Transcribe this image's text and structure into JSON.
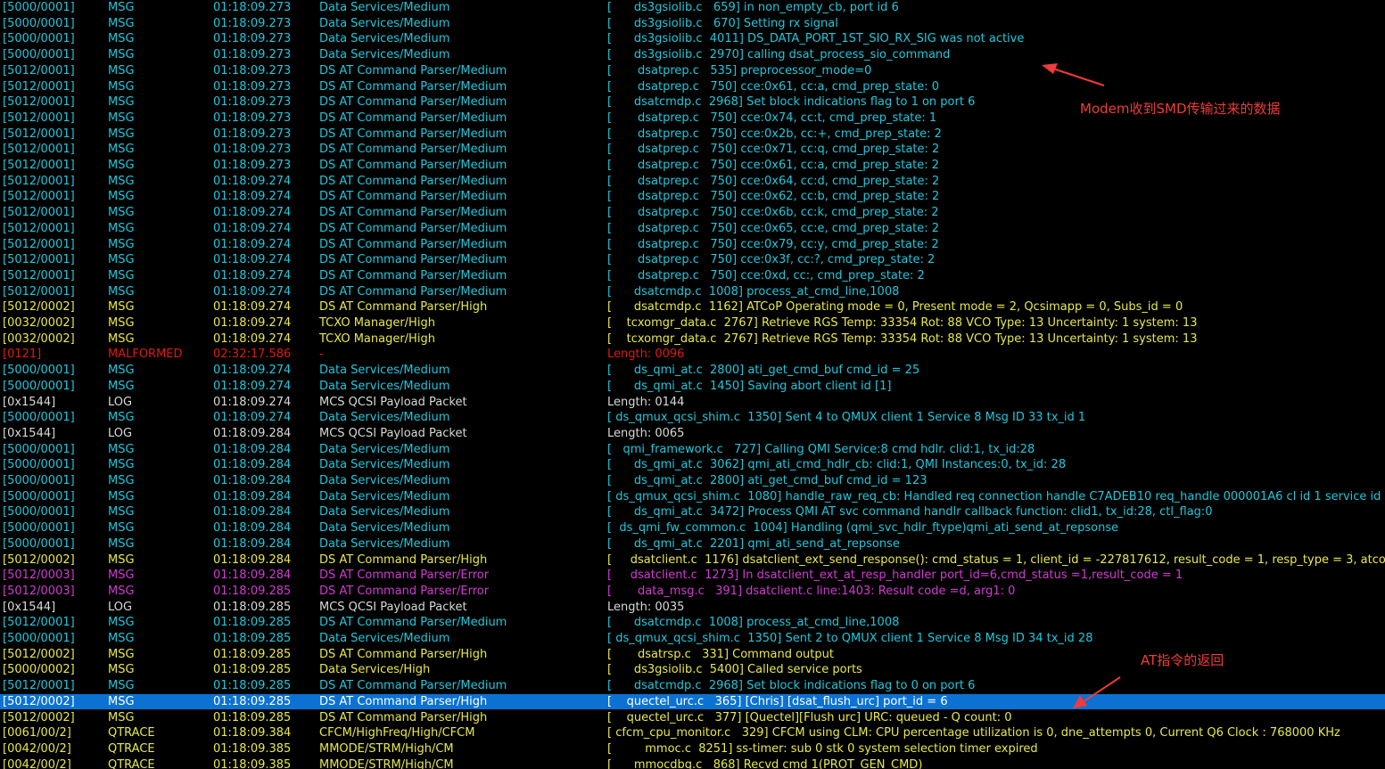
{
  "colors": {
    "cyan": "#1ec8dc",
    "yellow": "#e8e84a",
    "red": "#e01818",
    "white": "#d8d8d8",
    "magenta": "#d23ad2",
    "selection": "#0b72d4",
    "annotation": "#f23a3a"
  },
  "annotations": {
    "smd_note": "Modem收到SMD传输过来的数据",
    "at_return_note": "AT指令的返回"
  },
  "selected_row_index": 44,
  "rows": [
    {
      "id": "[5000/0001]",
      "type": "MSG",
      "time": "01:18:09.273",
      "subsystem": "Data Services/Medium",
      "message": "[      ds3gsiolib.c   659] in non_empty_cb, port id 6",
      "color": "cyan"
    },
    {
      "id": "[5000/0001]",
      "type": "MSG",
      "time": "01:18:09.273",
      "subsystem": "Data Services/Medium",
      "message": "[      ds3gsiolib.c   670] Setting rx signal",
      "color": "cyan"
    },
    {
      "id": "[5000/0001]",
      "type": "MSG",
      "time": "01:18:09.273",
      "subsystem": "Data Services/Medium",
      "message": "[      ds3gsiolib.c  4011] DS_DATA_PORT_1ST_SIO_RX_SIG was not active",
      "color": "cyan"
    },
    {
      "id": "[5000/0001]",
      "type": "MSG",
      "time": "01:18:09.273",
      "subsystem": "Data Services/Medium",
      "message": "[      ds3gsiolib.c  2970] calling dsat_process_sio_command",
      "color": "cyan"
    },
    {
      "id": "[5012/0001]",
      "type": "MSG",
      "time": "01:18:09.273",
      "subsystem": "DS AT Command Parser/Medium",
      "message": "[       dsatprep.c   535] preprocessor_mode=0",
      "color": "cyan"
    },
    {
      "id": "[5012/0001]",
      "type": "MSG",
      "time": "01:18:09.273",
      "subsystem": "DS AT Command Parser/Medium",
      "message": "[       dsatprep.c   750] cce:0x61, cc:a, cmd_prep_state: 0",
      "color": "cyan"
    },
    {
      "id": "[5012/0001]",
      "type": "MSG",
      "time": "01:18:09.273",
      "subsystem": "DS AT Command Parser/Medium",
      "message": "[      dsatcmdp.c  2968] Set block indications flag to 1 on port 6",
      "color": "cyan"
    },
    {
      "id": "[5012/0001]",
      "type": "MSG",
      "time": "01:18:09.273",
      "subsystem": "DS AT Command Parser/Medium",
      "message": "[       dsatprep.c   750] cce:0x74, cc:t, cmd_prep_state: 1",
      "color": "cyan"
    },
    {
      "id": "[5012/0001]",
      "type": "MSG",
      "time": "01:18:09.273",
      "subsystem": "DS AT Command Parser/Medium",
      "message": "[       dsatprep.c   750] cce:0x2b, cc:+, cmd_prep_state: 2",
      "color": "cyan"
    },
    {
      "id": "[5012/0001]",
      "type": "MSG",
      "time": "01:18:09.273",
      "subsystem": "DS AT Command Parser/Medium",
      "message": "[       dsatprep.c   750] cce:0x71, cc:q, cmd_prep_state: 2",
      "color": "cyan"
    },
    {
      "id": "[5012/0001]",
      "type": "MSG",
      "time": "01:18:09.273",
      "subsystem": "DS AT Command Parser/Medium",
      "message": "[       dsatprep.c   750] cce:0x61, cc:a, cmd_prep_state: 2",
      "color": "cyan"
    },
    {
      "id": "[5012/0001]",
      "type": "MSG",
      "time": "01:18:09.274",
      "subsystem": "DS AT Command Parser/Medium",
      "message": "[       dsatprep.c   750] cce:0x64, cc:d, cmd_prep_state: 2",
      "color": "cyan"
    },
    {
      "id": "[5012/0001]",
      "type": "MSG",
      "time": "01:18:09.274",
      "subsystem": "DS AT Command Parser/Medium",
      "message": "[       dsatprep.c   750] cce:0x62, cc:b, cmd_prep_state: 2",
      "color": "cyan"
    },
    {
      "id": "[5012/0001]",
      "type": "MSG",
      "time": "01:18:09.274",
      "subsystem": "DS AT Command Parser/Medium",
      "message": "[       dsatprep.c   750] cce:0x6b, cc:k, cmd_prep_state: 2",
      "color": "cyan"
    },
    {
      "id": "[5012/0001]",
      "type": "MSG",
      "time": "01:18:09.274",
      "subsystem": "DS AT Command Parser/Medium",
      "message": "[       dsatprep.c   750] cce:0x65, cc:e, cmd_prep_state: 2",
      "color": "cyan"
    },
    {
      "id": "[5012/0001]",
      "type": "MSG",
      "time": "01:18:09.274",
      "subsystem": "DS AT Command Parser/Medium",
      "message": "[       dsatprep.c   750] cce:0x79, cc:y, cmd_prep_state: 2",
      "color": "cyan"
    },
    {
      "id": "[5012/0001]",
      "type": "MSG",
      "time": "01:18:09.274",
      "subsystem": "DS AT Command Parser/Medium",
      "message": "[       dsatprep.c   750] cce:0x3f, cc:?, cmd_prep_state: 2",
      "color": "cyan"
    },
    {
      "id": "[5012/0001]",
      "type": "MSG",
      "time": "01:18:09.274",
      "subsystem": "DS AT Command Parser/Medium",
      "message": "[       dsatprep.c   750] cce:0xd, cc:, cmd_prep_state: 2",
      "color": "cyan"
    },
    {
      "id": "[5012/0001]",
      "type": "MSG",
      "time": "01:18:09.274",
      "subsystem": "DS AT Command Parser/Medium",
      "message": "[      dsatcmdp.c  1008] process_at_cmd_line,1008",
      "color": "cyan"
    },
    {
      "id": "[5012/0002]",
      "type": "MSG",
      "time": "01:18:09.274",
      "subsystem": "DS AT Command Parser/High",
      "message": "[      dsatcmdp.c  1162] ATCoP Operating mode = 0, Present mode = 2, Qcsimapp = 0, Subs_id = 0",
      "color": "yellow"
    },
    {
      "id": "[0032/0002]",
      "type": "MSG",
      "time": "01:18:09.274",
      "subsystem": "TCXO Manager/High",
      "message": "[    tcxomgr_data.c  2767] Retrieve RGS Temp: 33354 Rot: 88 VCO Type: 13 Uncertainty: 1 system: 13",
      "color": "yellow"
    },
    {
      "id": "[0032/0002]",
      "type": "MSG",
      "time": "01:18:09.274",
      "subsystem": "TCXO Manager/High",
      "message": "[    tcxomgr_data.c  2767] Retrieve RGS Temp: 33354 Rot: 88 VCO Type: 13 Uncertainty: 1 system: 13",
      "color": "yellow"
    },
    {
      "id": "[0121]",
      "type": "MALFORMED",
      "time": "02:32:17.586",
      "subsystem": "-",
      "message": "Length: 0096",
      "color": "red"
    },
    {
      "id": "[5000/0001]",
      "type": "MSG",
      "time": "01:18:09.274",
      "subsystem": "Data Services/Medium",
      "message": "[      ds_qmi_at.c  2800] ati_get_cmd_buf cmd_id = 25",
      "color": "cyan"
    },
    {
      "id": "[5000/0001]",
      "type": "MSG",
      "time": "01:18:09.274",
      "subsystem": "Data Services/Medium",
      "message": "[      ds_qmi_at.c  1450] Saving abort client id [1]",
      "color": "cyan"
    },
    {
      "id": "[0x1544]",
      "type": "LOG",
      "time": "01:18:09.274",
      "subsystem": "MCS QCSI Payload Packet",
      "message": "Length: 0144",
      "color": "white"
    },
    {
      "id": "[5000/0001]",
      "type": "MSG",
      "time": "01:18:09.274",
      "subsystem": "Data Services/Medium",
      "message": "[ ds_qmux_qcsi_shim.c  1350] Sent 4 to QMUX client 1 Service 8 Msg ID 33 tx_id 1",
      "color": "cyan"
    },
    {
      "id": "[0x1544]",
      "type": "LOG",
      "time": "01:18:09.284",
      "subsystem": "MCS QCSI Payload Packet",
      "message": "Length: 0065",
      "color": "white"
    },
    {
      "id": "[5000/0001]",
      "type": "MSG",
      "time": "01:18:09.284",
      "subsystem": "Data Services/Medium",
      "message": "[   qmi_framework.c   727] Calling QMI Service:8 cmd hdlr. clid:1, tx_id:28",
      "color": "cyan"
    },
    {
      "id": "[5000/0001]",
      "type": "MSG",
      "time": "01:18:09.284",
      "subsystem": "Data Services/Medium",
      "message": "[      ds_qmi_at.c  3062] qmi_ati_cmd_hdlr_cb: clid:1, QMI Instances:0, tx_id: 28",
      "color": "cyan"
    },
    {
      "id": "[5000/0001]",
      "type": "MSG",
      "time": "01:18:09.284",
      "subsystem": "Data Services/Medium",
      "message": "[      ds_qmi_at.c  2800] ati_get_cmd_buf cmd_id = 123",
      "color": "cyan"
    },
    {
      "id": "[5000/0001]",
      "type": "MSG",
      "time": "01:18:09.284",
      "subsystem": "Data Services/Medium",
      "message": "[ ds_qmux_qcsi_shim.c  1080] handle_raw_req_cb: Handled req connection handle C7ADEB10 req_handle 000001A6 cl id 1 service id",
      "color": "cyan"
    },
    {
      "id": "[5000/0001]",
      "type": "MSG",
      "time": "01:18:09.284",
      "subsystem": "Data Services/Medium",
      "message": "[      ds_qmi_at.c  3472] Process QMI AT svc command handlr callback function: clid1, tx_id:28, ctl_flag:0",
      "color": "cyan"
    },
    {
      "id": "[5000/0001]",
      "type": "MSG",
      "time": "01:18:09.284",
      "subsystem": "Data Services/Medium",
      "message": "[  ds_qmi_fw_common.c  1004] Handling (qmi_svc_hdlr_ftype)qmi_ati_send_at_repsonse",
      "color": "cyan"
    },
    {
      "id": "[5000/0001]",
      "type": "MSG",
      "time": "01:18:09.284",
      "subsystem": "Data Services/Medium",
      "message": "[      ds_qmi_at.c  2201] qmi_ati_send_at_repsonse",
      "color": "cyan"
    },
    {
      "id": "[5012/0002]",
      "type": "MSG",
      "time": "01:18:09.284",
      "subsystem": "DS AT Command Parser/High",
      "message": "[     dsatclient.c  1176] dsatclient_ext_send_response(): cmd_status = 1, client_id = -227817612, result_code = 1, resp_type = 3, atco",
      "color": "yellow"
    },
    {
      "id": "[5012/0003]",
      "type": "MSG",
      "time": "01:18:09.284",
      "subsystem": "DS AT Command Parser/Error",
      "message": "[     dsatclient.c  1273] In dsatclient_ext_at_resp_handler port_id=6,cmd_status =1,result_code = 1",
      "color": "magenta"
    },
    {
      "id": "[5012/0003]",
      "type": "MSG",
      "time": "01:18:09.285",
      "subsystem": "DS AT Command Parser/Error",
      "message": "[       data_msg.c   391] dsatclient.c line:1403: Result code =d, arg1: 0",
      "color": "magenta"
    },
    {
      "id": "[0x1544]",
      "type": "LOG",
      "time": "01:18:09.285",
      "subsystem": "MCS QCSI Payload Packet",
      "message": "Length: 0035",
      "color": "white"
    },
    {
      "id": "[5012/0001]",
      "type": "MSG",
      "time": "01:18:09.285",
      "subsystem": "DS AT Command Parser/Medium",
      "message": "[      dsatcmdp.c  1008] process_at_cmd_line,1008",
      "color": "cyan"
    },
    {
      "id": "[5000/0001]",
      "type": "MSG",
      "time": "01:18:09.285",
      "subsystem": "Data Services/Medium",
      "message": "[ ds_qmux_qcsi_shim.c  1350] Sent 2 to QMUX client 1 Service 8 Msg ID 34 tx_id 28",
      "color": "cyan"
    },
    {
      "id": "[5012/0002]",
      "type": "MSG",
      "time": "01:18:09.285",
      "subsystem": "DS AT Command Parser/High",
      "message": "[       dsatrsp.c   331] Command output",
      "color": "yellow"
    },
    {
      "id": "[5000/0002]",
      "type": "MSG",
      "time": "01:18:09.285",
      "subsystem": "Data Services/High",
      "message": "[      ds3gsiolib.c  5400] Called service ports",
      "color": "yellow"
    },
    {
      "id": "[5012/0001]",
      "type": "MSG",
      "time": "01:18:09.285",
      "subsystem": "DS AT Command Parser/Medium",
      "message": "[      dsatcmdp.c  2968] Set block indications flag to 0 on port 6",
      "color": "cyan"
    },
    {
      "id": "[5012/0002]",
      "type": "MSG",
      "time": "01:18:09.285",
      "subsystem": "DS AT Command Parser/High",
      "message": "[    quectel_urc.c   365] [Chris] [dsat_flush_urc] port_id = 6",
      "color": "yellow"
    },
    {
      "id": "[5012/0002]",
      "type": "MSG",
      "time": "01:18:09.285",
      "subsystem": "DS AT Command Parser/High",
      "message": "[    quectel_urc.c   377] [Quectel][Flush urc] URC: queued - Q count: 0",
      "color": "yellow"
    },
    {
      "id": "[0061/00/2]",
      "type": "QTRACE",
      "time": "01:18:09.384",
      "subsystem": "CFCM/HighFreq/High/CFCM",
      "message": "[ cfcm_cpu_monitor.c   329] CFCM using CLM: CPU percentage utilization is 0, dne_attempts 0, Current Q6 Clock : 768000 KHz",
      "color": "yellow"
    },
    {
      "id": "[0042/00/2]",
      "type": "QTRACE",
      "time": "01:18:09.385",
      "subsystem": "MMODE/STRM/High/CM",
      "message": "[         mmoc.c  8251] ss-timer: sub 0 stk 0 system selection timer expired",
      "color": "yellow"
    },
    {
      "id": "[0042/00/2]",
      "type": "QTRACE",
      "time": "01:18:09.385",
      "subsystem": "MMODE/STRM/High/CM",
      "message": "[      mmocdbg.c   868] Recvd cmd 1(PROT_GEN_CMD)",
      "color": "yellow"
    }
  ]
}
